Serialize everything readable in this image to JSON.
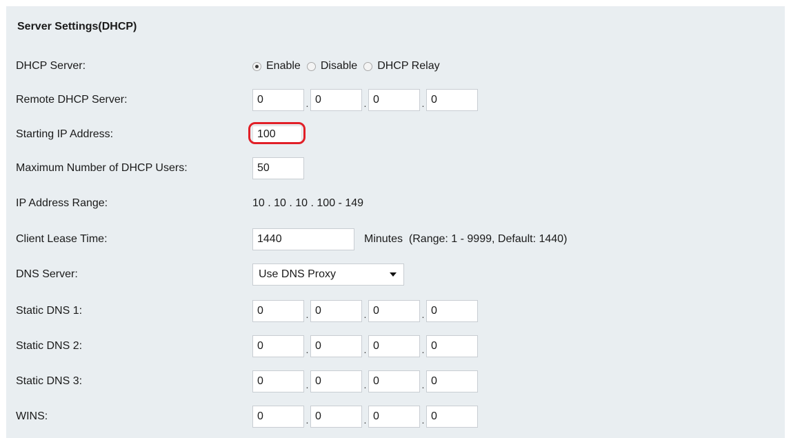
{
  "section": {
    "title": "Server Settings(DHCP)"
  },
  "dhcp_server": {
    "label": "DHCP Server:",
    "options": [
      "Enable",
      "Disable",
      "DHCP Relay"
    ],
    "selected": "Enable"
  },
  "remote_dhcp_server": {
    "label": "Remote DHCP Server:",
    "octets": [
      "0",
      "0",
      "0",
      "0"
    ]
  },
  "starting_ip": {
    "label": "Starting IP Address:",
    "value": "100"
  },
  "max_users": {
    "label": "Maximum Number of DHCP Users:",
    "value": "50"
  },
  "ip_range": {
    "label": "IP Address Range:",
    "value": "10 . 10 . 10 . 100 - 149"
  },
  "lease_time": {
    "label": "Client Lease Time:",
    "value": "1440",
    "hint": "Minutes  (Range: 1 - 9999, Default: 1440)"
  },
  "dns_server": {
    "label": "DNS Server:",
    "selected": "Use DNS Proxy"
  },
  "static_dns_1": {
    "label": "Static DNS 1:",
    "octets": [
      "0",
      "0",
      "0",
      "0"
    ]
  },
  "static_dns_2": {
    "label": "Static DNS 2:",
    "octets": [
      "0",
      "0",
      "0",
      "0"
    ]
  },
  "static_dns_3": {
    "label": "Static DNS 3:",
    "octets": [
      "0",
      "0",
      "0",
      "0"
    ]
  },
  "wins": {
    "label": "WINS:",
    "octets": [
      "0",
      "0",
      "0",
      "0"
    ]
  },
  "colors": {
    "panel_bg": "#e9eef1",
    "highlight": "#e11f27",
    "field_border": "#c8cdd2"
  },
  "icons": {
    "select_caret": "caret-down-icon",
    "radio": "radio-icon"
  }
}
